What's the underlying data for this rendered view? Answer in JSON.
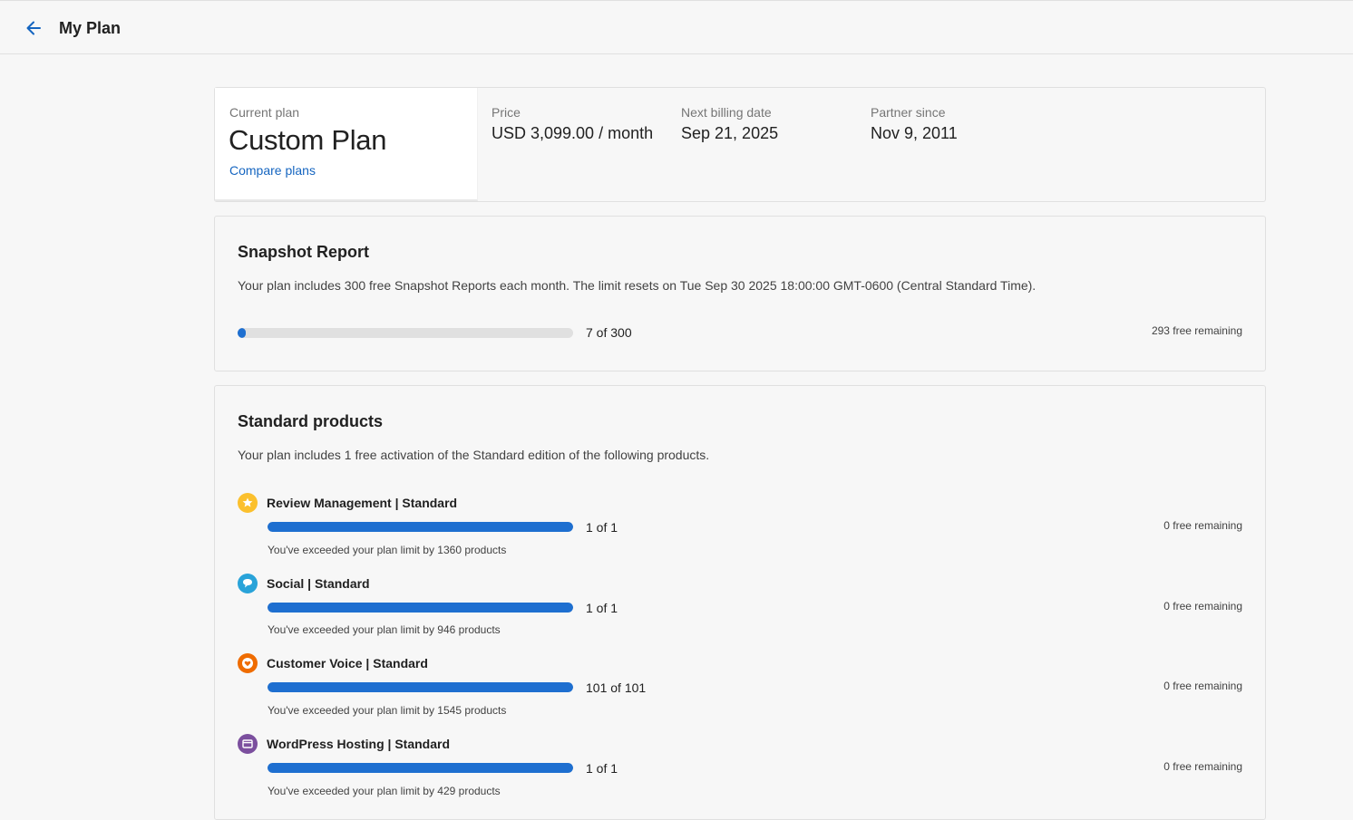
{
  "header": {
    "title": "My Plan",
    "back_icon": "arrow-left-icon"
  },
  "plan": {
    "current_label": "Current plan",
    "name": "Custom Plan",
    "compare_link": "Compare plans",
    "price_label": "Price",
    "price_value": "USD 3,099.00 / month",
    "billing_label": "Next billing date",
    "billing_value": "Sep 21, 2025",
    "partner_label": "Partner since",
    "partner_value": "Nov 9, 2011"
  },
  "snapshot": {
    "title": "Snapshot Report",
    "description": "Your plan includes 300 free Snapshot Reports each month. The limit resets on Tue Sep 30 2025 18:00:00 GMT-0600 (Central Standard Time).",
    "used": 7,
    "total": 300,
    "count_text": "7 of 300",
    "remaining": "293 free remaining"
  },
  "standard": {
    "title": "Standard products",
    "description": "Your plan includes 1 free activation of the Standard edition of the following products.",
    "products": [
      {
        "name": "Review Management | Standard",
        "icon": "star-icon",
        "color": "#fbc02d",
        "used": 1,
        "total": 1,
        "count_text": "1 of 1",
        "remaining": "0 free remaining",
        "exceed": "You've exceeded your plan limit by 1360 products"
      },
      {
        "name": "Social | Standard",
        "icon": "chat-bubble-icon",
        "color": "#29a3d9",
        "used": 1,
        "total": 1,
        "count_text": "1 of 1",
        "remaining": "0 free remaining",
        "exceed": "You've exceeded your plan limit by 946 products"
      },
      {
        "name": "Customer Voice | Standard",
        "icon": "heart-icon",
        "color": "#ef6c00",
        "used": 101,
        "total": 101,
        "count_text": "101 of 101",
        "remaining": "0 free remaining",
        "exceed": "You've exceeded your plan limit by 1545 products"
      },
      {
        "name": "WordPress Hosting | Standard",
        "icon": "browser-window-icon",
        "color": "#7b4f9e",
        "used": 1,
        "total": 1,
        "count_text": "1 of 1",
        "remaining": "0 free remaining",
        "exceed": "You've exceeded your plan limit by 429 products"
      }
    ]
  }
}
